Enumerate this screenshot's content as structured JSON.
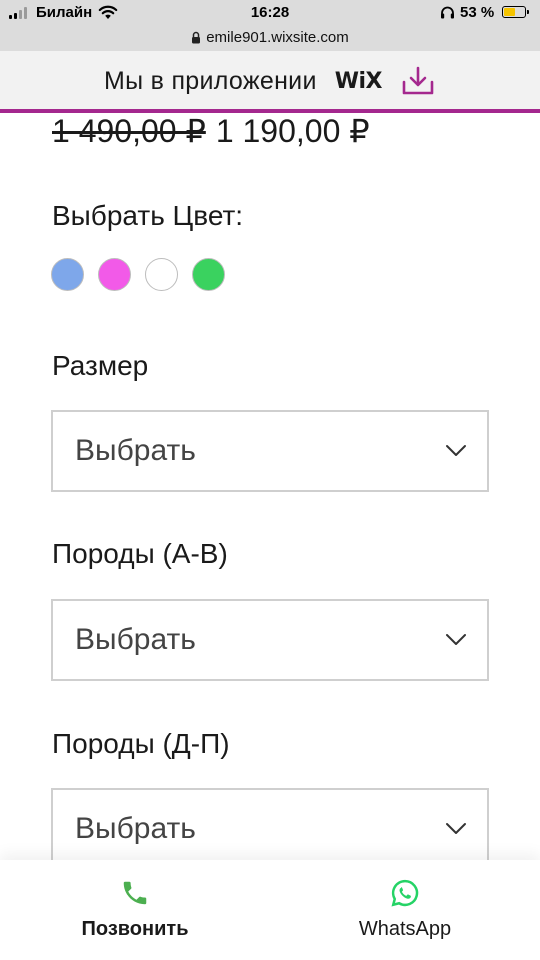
{
  "status_bar": {
    "carrier": "Билайн",
    "time": "16:28",
    "battery_percent": "53 %",
    "battery_level": 0.53
  },
  "browser": {
    "url": "emile901.wixsite.com"
  },
  "app_banner": {
    "text": "Мы в приложении",
    "brand": "WiX"
  },
  "product": {
    "old_price": "1 490,00 ₽",
    "price": "1 190,00 ₽"
  },
  "color_picker": {
    "label": "Выбрать Цвет:",
    "swatches": [
      "#7ea7ea",
      "#f25ae8",
      "#ffffff",
      "#3ad25f"
    ]
  },
  "options": [
    {
      "label": "Размер",
      "value": "Выбрать"
    },
    {
      "label": "Породы (А-В)",
      "value": "Выбрать"
    },
    {
      "label": "Породы (Д-П)",
      "value": "Выбрать"
    }
  ],
  "bottom_bar": {
    "call_label": "Позвонить",
    "whatsapp_label": "WhatsApp"
  },
  "colors": {
    "accent": "#a4288e",
    "call_green": "#4caf50",
    "whatsapp_green": "#25d366"
  },
  "icons": [
    "signal-icon",
    "wifi-icon",
    "lock-icon",
    "headphones-icon",
    "battery-icon",
    "download-icon",
    "chevron-down-icon",
    "phone-icon",
    "whatsapp-icon"
  ]
}
